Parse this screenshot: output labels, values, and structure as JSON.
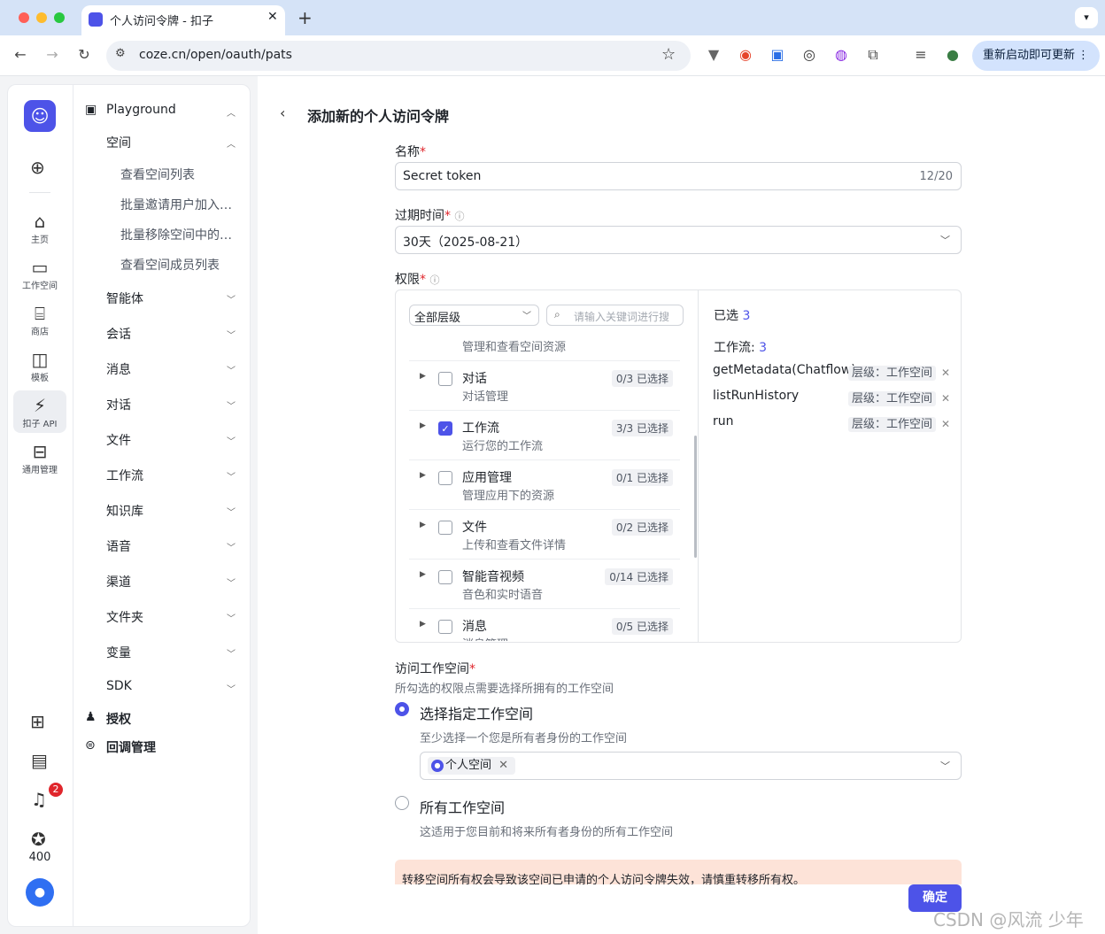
{
  "browser": {
    "tab_title": "个人访问令牌 - 扣子",
    "url": "coze.cn/open/oauth/pats",
    "relaunch_label": "重新启动即可更新"
  },
  "rail": {
    "items": [
      {
        "label": "主页"
      },
      {
        "label": "工作空间"
      },
      {
        "label": "商店"
      },
      {
        "label": "模板"
      },
      {
        "label": "扣子 API"
      },
      {
        "label": "通用管理"
      }
    ],
    "notification_count": "2",
    "credits": "400"
  },
  "nav": {
    "playground": "Playground",
    "space": "空间",
    "space_items": [
      "查看空间列表",
      "批量邀请用户加入…",
      "批量移除空间中的…",
      "查看空间成员列表"
    ],
    "groups": [
      "智能体",
      "会话",
      "消息",
      "对话",
      "文件",
      "工作流",
      "知识库",
      "语音",
      "渠道",
      "文件夹",
      "变量",
      "SDK"
    ],
    "auth": "授权",
    "callback": "回调管理"
  },
  "form": {
    "page_title": "添加新的个人访问令牌",
    "name_label": "名称",
    "name_value": "Secret token",
    "name_count": "12/20",
    "expire_label": "过期时间",
    "expire_value": "30天（2025-08-21）",
    "perm_label": "权限",
    "level_select": "全部层级",
    "search_placeholder": "请输入关键词进行搜",
    "perm_header_desc": "管理和查看空间资源",
    "perms": [
      {
        "title": "对话",
        "desc": "对话管理",
        "count": "0/3 已选择",
        "checked": false
      },
      {
        "title": "工作流",
        "desc": "运行您的工作流",
        "count": "3/3 已选择",
        "checked": true
      },
      {
        "title": "应用管理",
        "desc": "管理应用下的资源",
        "count": "0/1 已选择",
        "checked": false
      },
      {
        "title": "文件",
        "desc": "上传和查看文件详情",
        "count": "0/2 已选择",
        "checked": false
      },
      {
        "title": "智能音视频",
        "desc": "音色和实时语音",
        "count": "0/14 已选择",
        "checked": false
      },
      {
        "title": "消息",
        "desc": "消息管理",
        "count": "0/5 已选择",
        "checked": false
      }
    ],
    "selected_label": "已选",
    "selected_count": "3",
    "workflow_label": "工作流:",
    "workflow_count": "3",
    "selected_items": [
      {
        "name": "getMetadata(Chatflow)",
        "level": "层级：工作空间"
      },
      {
        "name": "listRunHistory",
        "level": "层级：工作空间"
      },
      {
        "name": "run",
        "level": "层级：工作空间"
      }
    ],
    "access_label": "访问工作空间",
    "access_desc": "所勾选的权限点需要选择所拥有的工作空间",
    "opt_specific": "选择指定工作空间",
    "opt_specific_desc": "至少选择一个您是所有者身份的工作空间",
    "personal_space_tag": "个人空间",
    "opt_all": "所有工作空间",
    "opt_all_desc": "这适用于您目前和将来所有者身份的所有工作空间",
    "warning": "转移空间所有权会导致该空间已申请的个人访问令牌失效，请慎重转移所有权。",
    "confirm": "确定"
  },
  "watermark": "CSDN @风流 少年",
  "colors": {
    "accent": "#4d53e8",
    "warning_bg": "#fde3d8",
    "badge": "#e0262c"
  }
}
